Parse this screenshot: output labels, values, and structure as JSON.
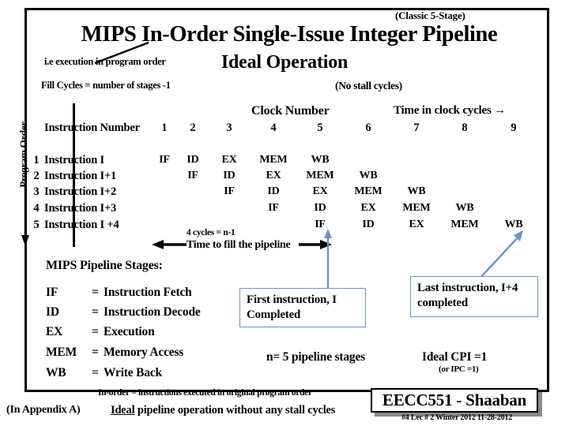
{
  "slide": {
    "classic_note": "(Classic 5-Stage)",
    "title": "MIPS In-Order Single-Issue Integer Pipeline",
    "subtitle": "Ideal Operation",
    "ie_note": "i.e execution in program order",
    "fill_cycles_note": "Fill Cycles =  number of stages -1",
    "no_stall_note": "(No stall cycles)"
  },
  "program_order": {
    "label": "Program Order"
  },
  "table": {
    "clock_number_header": "Clock Number",
    "time_axis_header": "Time in clock cycles →",
    "instruction_number_header": "Instruction Number",
    "columns": [
      "1",
      "2",
      "3",
      "4",
      "5",
      "6",
      "7",
      "8",
      "9"
    ],
    "rows": [
      {
        "num": "1",
        "label": "Instruction I",
        "cells": [
          "IF",
          "ID",
          "EX",
          "MEM",
          "WB",
          "",
          "",
          "",
          ""
        ]
      },
      {
        "num": "2",
        "label": "Instruction I+1",
        "cells": [
          "",
          "IF",
          "ID",
          "EX",
          "MEM",
          "WB",
          "",
          "",
          ""
        ]
      },
      {
        "num": "3",
        "label": "Instruction I+2",
        "cells": [
          "",
          "",
          "IF",
          "ID",
          "EX",
          "MEM",
          "WB",
          "",
          ""
        ]
      },
      {
        "num": "4",
        "label": "Instruction I+3",
        "cells": [
          "",
          "",
          "",
          "IF",
          "ID",
          "EX",
          "MEM",
          "WB",
          ""
        ]
      },
      {
        "num": "5",
        "label": "Instruction I +4",
        "cells": [
          "",
          "",
          "",
          "",
          "IF",
          "ID",
          "EX",
          "MEM",
          "WB"
        ]
      }
    ]
  },
  "fill_band": {
    "cycles_note": "4 cycles = n-1",
    "fill_text": "Time to fill the pipeline"
  },
  "stages": {
    "title": "MIPS Pipeline Stages:",
    "eq": "=",
    "items": [
      {
        "abbr": "IF",
        "name": "Instruction Fetch"
      },
      {
        "abbr": "ID",
        "name": "Instruction Decode"
      },
      {
        "abbr": "EX",
        "name": "Execution"
      },
      {
        "abbr": "MEM",
        "name": "Memory Access"
      },
      {
        "abbr": "WB",
        "name": "Write Back"
      }
    ]
  },
  "callouts": {
    "first": "First instruction, I Completed",
    "last": "Last instruction, I+4 completed",
    "border_color": "#6f90c8"
  },
  "notes": {
    "n_stages": "n= 5 pipeline stages",
    "ideal_cpi": "Ideal CPI =1",
    "ipc_note": "(or IPC =1)",
    "in_order": "In-order =  instructions executed in original program order",
    "appendix": "(In  Appendix A)",
    "ideal_prefix": "Ideal",
    "ideal_rest": " pipeline operation without any stall cycles"
  },
  "footer": {
    "badge": "EECC551 - Shaaban",
    "meta": "#4   Lec # 2   Winter 2012   11-28-2012"
  }
}
